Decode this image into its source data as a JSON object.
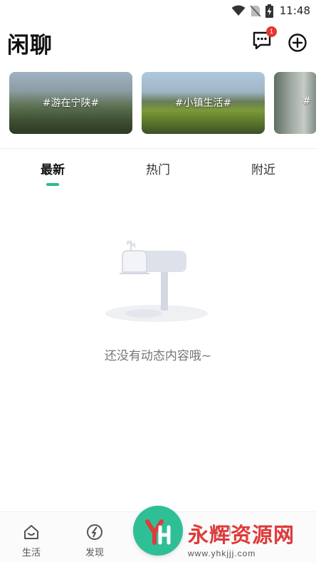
{
  "status_bar": {
    "time": "11:48",
    "icons": [
      "wifi-icon",
      "no-sim-icon",
      "battery-charging-icon"
    ]
  },
  "header": {
    "title": "闲聊",
    "message_badge_count": "1",
    "icons": [
      "message-icon",
      "add-circle-icon"
    ]
  },
  "topics": [
    {
      "label": "#游在宁陕#"
    },
    {
      "label": "#小镇生活#"
    },
    {
      "label": "#"
    }
  ],
  "tabs": [
    {
      "label": "最新",
      "active": true
    },
    {
      "label": "热门",
      "active": false
    },
    {
      "label": "附近",
      "active": false
    }
  ],
  "empty_state": {
    "message": "还没有动态内容哦~",
    "icon": "mailbox-icon"
  },
  "bottom_nav": [
    {
      "label": "生活",
      "icon": "home-icon"
    },
    {
      "label": "发现",
      "icon": "compass-icon"
    },
    {
      "label": "",
      "icon": "publish-icon"
    },
    {
      "label": "",
      "icon": "chat-icon"
    },
    {
      "label": "",
      "icon": "user-icon"
    }
  ],
  "watermark": {
    "title": "永辉资源网",
    "url": "www.yhkjjj.com"
  },
  "colors": {
    "accent": "#2dbb94",
    "badge": "#e8342e",
    "watermark": "#e03a3a"
  }
}
